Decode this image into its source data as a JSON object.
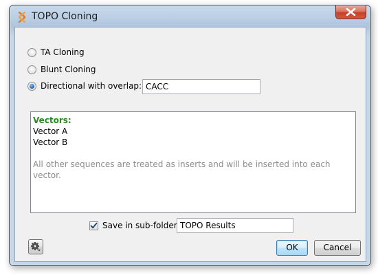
{
  "window": {
    "title": "TOPO Cloning"
  },
  "options": {
    "ta_cloning": {
      "label": "TA Cloning",
      "selected": false
    },
    "blunt_cloning": {
      "label": "Blunt Cloning",
      "selected": false
    },
    "directional": {
      "label": "Directional with overlap:",
      "selected": true,
      "overlap_value": "CACC"
    }
  },
  "vectors": {
    "heading": "Vectors:",
    "items": [
      "Vector A",
      "Vector B"
    ],
    "note": "All other sequences are treated as inserts and will be inserted into each vector."
  },
  "subfolder": {
    "label": "Save in sub-folder",
    "checked": true,
    "value": "TOPO Results"
  },
  "buttons": {
    "ok": "OK",
    "cancel": "Cancel"
  },
  "colors": {
    "vectors_heading": "#2b8a20",
    "note_text": "#8c8c8c",
    "client_bg": "#f0f0f0"
  },
  "icons": {
    "app": "topo-app-icon",
    "close": "close-icon",
    "settings": "gear-icon"
  }
}
